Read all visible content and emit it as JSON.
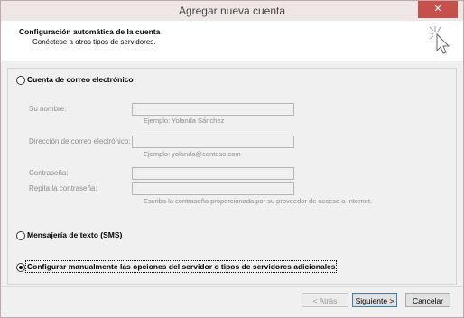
{
  "window": {
    "title": "Agregar nueva cuenta",
    "close_label": "✕"
  },
  "header": {
    "title": "Configuración automática de la cuenta",
    "subtitle": "Conéctese a otros tipos de servidores."
  },
  "options": {
    "email": {
      "label": "Cuenta de correo electrónico",
      "selected": false
    },
    "sms": {
      "label": "Mensajería de texto (SMS)",
      "selected": false
    },
    "manual": {
      "label": "Configurar manualmente las opciones del servidor o tipos de servidores adicionales",
      "selected": true
    }
  },
  "fields": {
    "name": {
      "label": "Su nombre:",
      "value": "",
      "hint": "Ejemplo: Yolanda Sánchez"
    },
    "email": {
      "label": "Dirección de correo electrónico:",
      "value": "",
      "hint": "Ejemplo: yolanda@contoso.com"
    },
    "password": {
      "label": "Contraseña:",
      "value": ""
    },
    "password_confirm": {
      "label": "Repita la contraseña:",
      "value": "",
      "hint": "Escriba la contraseña proporcionada por su proveedor de acceso a Internet."
    }
  },
  "buttons": {
    "back": "< Atrás",
    "next": "Siguiente >",
    "cancel": "Cancelar"
  },
  "icons": {
    "wizard": "cursor-sparkle-icon"
  }
}
